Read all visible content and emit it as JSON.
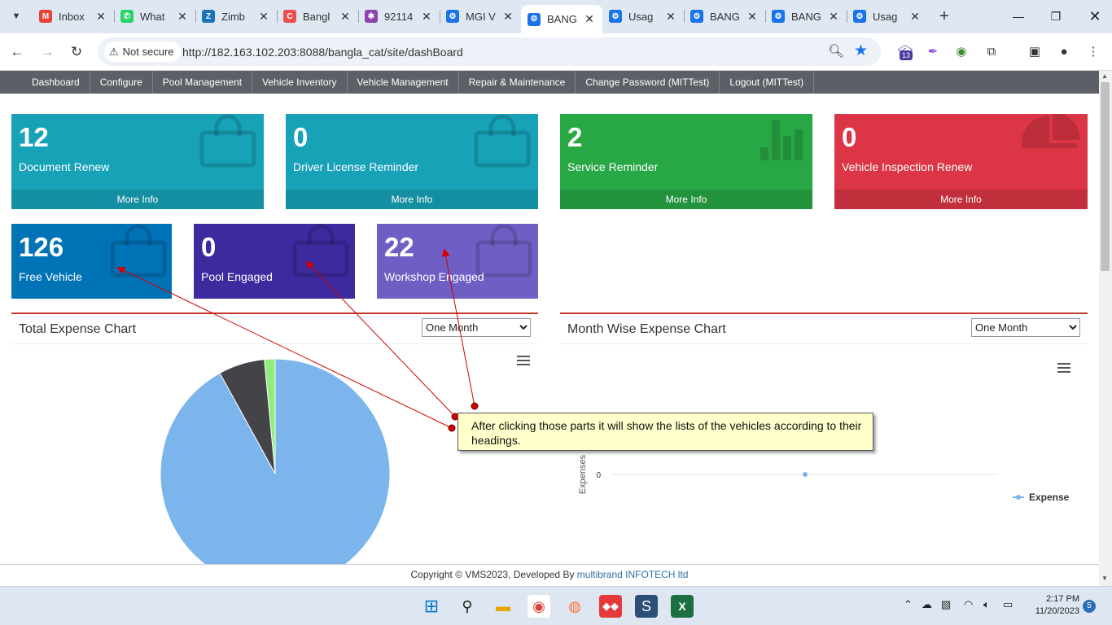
{
  "browser": {
    "tabs": [
      {
        "title": "Inbox",
        "favicon": "gmail-icon",
        "color": "#ea4335",
        "glyph": "M"
      },
      {
        "title": "What",
        "favicon": "whatsapp-icon",
        "color": "#25d366",
        "glyph": "✆"
      },
      {
        "title": "Zimb",
        "favicon": "zimbra-icon",
        "color": "#1b75bb",
        "glyph": "Z"
      },
      {
        "title": "Bangl",
        "favicon": "bangla-icon",
        "color": "#e94f4f",
        "glyph": "C"
      },
      {
        "title": "92114",
        "favicon": "colorful-icon",
        "color": "#8e44ad",
        "glyph": "✱"
      },
      {
        "title": "MGI V",
        "favicon": "gear-icon",
        "color": "#1a73e8",
        "glyph": "⚙"
      },
      {
        "title": "BANG",
        "favicon": "gear-icon",
        "color": "#1a73e8",
        "glyph": "⚙",
        "active": true
      },
      {
        "title": "Usag",
        "favicon": "gear-icon",
        "color": "#1a73e8",
        "glyph": "⚙"
      },
      {
        "title": "BANG",
        "favicon": "gear-icon",
        "color": "#1a73e8",
        "glyph": "⚙"
      },
      {
        "title": "BANG",
        "favicon": "gear-icon",
        "color": "#1a73e8",
        "glyph": "⚙"
      },
      {
        "title": "Usag",
        "favicon": "gear-icon",
        "color": "#1a73e8",
        "glyph": "⚙"
      }
    ],
    "security_label": "Not secure",
    "url": "http://182.163.102.203:8088/bangla_cat/site/dashBoard",
    "extension_badge": "13"
  },
  "nav": {
    "items": [
      "Dashboard",
      "Configure",
      "Pool Management",
      "Vehicle Inventory",
      "Vehicle Management",
      "Repair & Maintenance",
      "Change Password (MITTest)",
      "Logout (MITTest)"
    ]
  },
  "boxes_row1": [
    {
      "count": "12",
      "label": "Document Renew",
      "more": "More Info",
      "color": "#17a2b8",
      "icon": "shopping-bag-icon"
    },
    {
      "count": "0",
      "label": "Driver License Reminder",
      "more": "More Info",
      "color": "#17a2b8",
      "icon": "shopping-bag-icon"
    },
    {
      "count": "2",
      "label": "Service Reminder",
      "more": "More Info",
      "color": "#28a745",
      "icon": "bar-chart-icon"
    },
    {
      "count": "0",
      "label": "Vehicle Inspection Renew",
      "more": "More Info",
      "color": "#dc3545",
      "icon": "pie-chart-icon"
    }
  ],
  "boxes_row2": [
    {
      "count": "126",
      "label": "Free Vehicle",
      "color": "#0073b7",
      "icon": "shopping-bag-icon"
    },
    {
      "count": "0",
      "label": "Pool Engaged",
      "color": "#3d2a9e",
      "icon": "shopping-bag-icon"
    },
    {
      "count": "22",
      "label": "Workshop Engaged",
      "color": "#6f5fc4",
      "icon": "shopping-bag-icon"
    }
  ],
  "panels": {
    "total": {
      "title": "Total Expense Chart",
      "period": "One Month"
    },
    "month": {
      "title": "Month Wise Expense Chart",
      "period": "One Month"
    }
  },
  "chart_data": [
    {
      "type": "pie",
      "title": "",
      "categories": [
        "",
        "",
        ""
      ],
      "values": [
        92,
        6.5,
        1.5
      ],
      "colors": [
        "#7cb5ec",
        "#434348",
        "#90ed7d"
      ]
    },
    {
      "type": "line",
      "title": "",
      "ylabel": "Expenses",
      "yticks": [
        "0"
      ],
      "series": [
        {
          "name": "Expense",
          "values": [
            0
          ]
        }
      ],
      "legend": "bottom-right"
    }
  ],
  "annotation": {
    "text": "After clicking those parts it will show the lists of the vehicles according to their headings."
  },
  "footer": {
    "text": "Copyright © VMS2023, Developed By ",
    "link": "multibrand INFOTECH ltd"
  },
  "taskbar": {
    "time": "2:17 PM",
    "date": "11/20/2023",
    "notifications": "5"
  }
}
